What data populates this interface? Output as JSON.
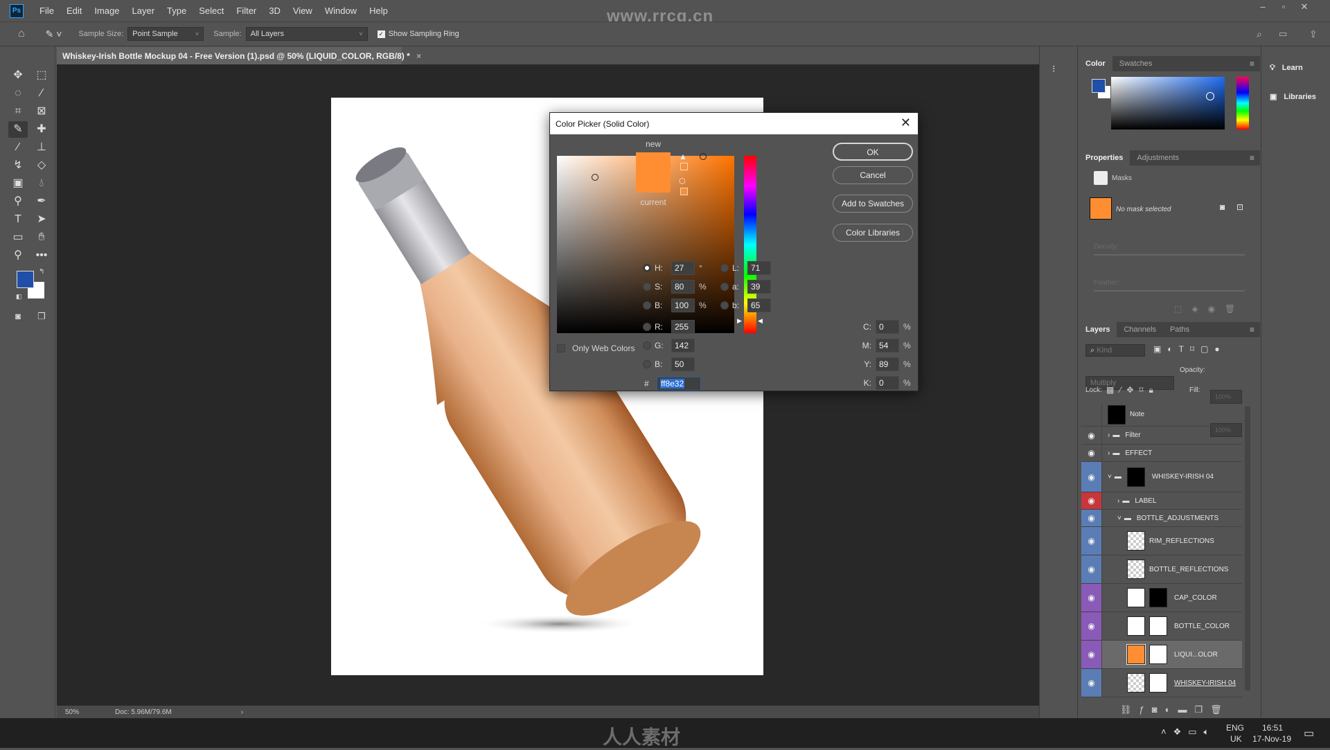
{
  "app": {
    "logo": "Ps",
    "menu": [
      "File",
      "Edit",
      "Image",
      "Layer",
      "Type",
      "Select",
      "Filter",
      "3D",
      "View",
      "Window",
      "Help"
    ],
    "watermark_top": "www.rrcg.cn",
    "watermark_bottom": "人人素材"
  },
  "options_bar": {
    "sample_size_label": "Sample Size:",
    "sample_size_value": "Point Sample",
    "sample_label": "Sample:",
    "sample_value": "All Layers",
    "show_sampling_ring_label": "Show Sampling Ring",
    "show_sampling_ring_checked": true
  },
  "document": {
    "tab_title": "Whiskey-Irish Bottle Mockup 04 - Free Version (1).psd @ 50% (LIQUID_COLOR, RGB/8) *",
    "close": "×"
  },
  "toolbar": {
    "tools": [
      "move",
      "marquee",
      "lasso",
      "quick-selection",
      "crop",
      "frame",
      "eyedropper",
      "healing-brush",
      "brush",
      "clone-stamp",
      "history-brush",
      "eraser",
      "gradient",
      "blur",
      "dodge",
      "pen",
      "type",
      "path-selection",
      "rectangle",
      "hand",
      "zoom",
      "more"
    ],
    "active_tool": "eyedropper",
    "foreground_color": "#1f4fa8",
    "background_color": "#ffffff"
  },
  "status_bar": {
    "zoom": "50%",
    "doc": "Doc: 5.96M/79.6M"
  },
  "color_picker": {
    "title": "Color Picker (Solid Color)",
    "ok": "OK",
    "cancel": "Cancel",
    "add_to_swatches": "Add to Swatches",
    "color_libraries": "Color Libraries",
    "new_label": "new",
    "current_label": "current",
    "new_color": "#ff8e32",
    "current_color": "#ff8e32",
    "only_web_colors": "Only Web Colors",
    "only_web_colors_checked": false,
    "selected_mode": "H",
    "fields": {
      "H": {
        "label": "H:",
        "value": "27",
        "unit": "°"
      },
      "S": {
        "label": "S:",
        "value": "80",
        "unit": "%"
      },
      "Bv": {
        "label": "B:",
        "value": "100",
        "unit": "%"
      },
      "R": {
        "label": "R:",
        "value": "255"
      },
      "G": {
        "label": "G:",
        "value": "142"
      },
      "Bc": {
        "label": "B:",
        "value": "50"
      },
      "L": {
        "label": "L:",
        "value": "71"
      },
      "a": {
        "label": "a:",
        "value": "39"
      },
      "b": {
        "label": "b:",
        "value": "65"
      },
      "C": {
        "label": "C:",
        "value": "0",
        "unit": "%"
      },
      "M": {
        "label": "M:",
        "value": "54",
        "unit": "%"
      },
      "Y": {
        "label": "Y:",
        "value": "89",
        "unit": "%"
      },
      "K": {
        "label": "K:",
        "value": "0",
        "unit": "%"
      }
    },
    "hex_label": "#",
    "hex": "ff8e32"
  },
  "color_panel": {
    "tabs": [
      "Color",
      "Swatches"
    ],
    "foreground": "#1f4fa8"
  },
  "properties_panel": {
    "tabs": [
      "Properties",
      "Adjustments"
    ],
    "section": "Masks",
    "no_mask": "No mask selected",
    "density_label": "Density:",
    "feather_label": "Feather:"
  },
  "side_buttons": {
    "learn": "Learn",
    "libraries": "Libraries"
  },
  "layers_panel": {
    "tabs": [
      "Layers",
      "Channels",
      "Paths"
    ],
    "search_placeholder": "Kind",
    "blend_mode": "Multiply",
    "opacity_label": "Opacity:",
    "opacity_value": "100%",
    "lock_label": "Lock:",
    "fill_label": "Fill:",
    "fill_value": "100%",
    "layers": [
      {
        "name": "Note",
        "visible": false,
        "tag": "",
        "indent": 0,
        "type": "note"
      },
      {
        "name": "Filter",
        "visible": true,
        "tag": "",
        "indent": 0,
        "type": "group-closed"
      },
      {
        "name": "EFFECT",
        "visible": true,
        "tag": "",
        "indent": 0,
        "type": "group-closed"
      },
      {
        "name": "WHISKEY-IRISH 04",
        "visible": true,
        "tag": "#5b7db5",
        "indent": 0,
        "type": "group-open-mask"
      },
      {
        "name": "LABEL",
        "visible": true,
        "tag": "#c8363b",
        "indent": 1,
        "type": "group-closed"
      },
      {
        "name": "BOTTLE_ADJUSTMENTS",
        "visible": true,
        "tag": "#5b7db5",
        "indent": 1,
        "type": "group-open"
      },
      {
        "name": "RIM_REFLECTIONS",
        "visible": true,
        "tag": "#5b7db5",
        "indent": 2,
        "type": "pixel"
      },
      {
        "name": "BOTTLE_REFLECTIONS",
        "visible": true,
        "tag": "#5b7db5",
        "indent": 2,
        "type": "pixel"
      },
      {
        "name": "CAP_COLOR",
        "visible": true,
        "tag": "#8a5ab8",
        "indent": 2,
        "type": "fill-white"
      },
      {
        "name": "BOTTLE_COLOR",
        "visible": true,
        "tag": "#8a5ab8",
        "indent": 2,
        "type": "fill-white"
      },
      {
        "name": "LIQUI...OLOR",
        "visible": true,
        "tag": "#8a5ab8",
        "indent": 2,
        "type": "fill-orange",
        "selected": true
      },
      {
        "name": "WHISKEY-IRISH 04",
        "visible": true,
        "tag": "#5b7db5",
        "indent": 2,
        "type": "smart"
      }
    ]
  },
  "taskbar": {
    "lang": "ENG",
    "region": "UK",
    "time": "16:51",
    "date": "17-Nov-19"
  }
}
